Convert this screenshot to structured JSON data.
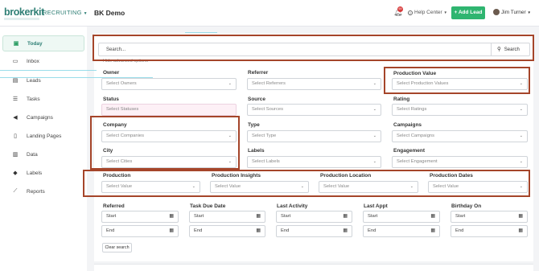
{
  "header": {
    "logo": "brokerkit",
    "app_switch": "RECRUITING",
    "page_title": "BK Demo",
    "notification_count": "69",
    "help_label": "Help Center",
    "add_lead_label": "+ Add Lead",
    "user_name": "Jim Turner"
  },
  "sidebar": {
    "items": [
      {
        "label": "Today",
        "icon": "calendar-check-icon",
        "glyph": "▣"
      },
      {
        "label": "Inbox",
        "icon": "inbox-icon",
        "glyph": "▭"
      },
      {
        "label": "Leads",
        "icon": "contact-card-icon",
        "glyph": "▤"
      },
      {
        "label": "Tasks",
        "icon": "list-icon",
        "glyph": "☰"
      },
      {
        "label": "Campaigns",
        "icon": "megaphone-icon",
        "glyph": "◀"
      },
      {
        "label": "Landing Pages",
        "icon": "document-icon",
        "glyph": "▯"
      },
      {
        "label": "Data",
        "icon": "database-icon",
        "glyph": "▥"
      },
      {
        "label": "Labels",
        "icon": "tags-icon",
        "glyph": "◆"
      },
      {
        "label": "Reports",
        "icon": "line-chart-icon",
        "glyph": "⟋"
      }
    ]
  },
  "search": {
    "placeholder": "Search...",
    "button_label": "Search",
    "toggle_label": "Hide advanced options"
  },
  "filters": {
    "owner": {
      "label": "Owner",
      "placeholder": "Select Owners"
    },
    "referrer": {
      "label": "Referrer",
      "placeholder": "Select Referrers"
    },
    "production_value": {
      "label": "Production Value",
      "placeholder": "Select Production Values"
    },
    "status": {
      "label": "Status",
      "placeholder": "Select Statuses"
    },
    "source": {
      "label": "Source",
      "placeholder": "Select Sources"
    },
    "rating": {
      "label": "Rating",
      "placeholder": "Select Ratings"
    },
    "company": {
      "label": "Company",
      "placeholder": "Select Companies"
    },
    "type": {
      "label": "Type",
      "placeholder": "Select Type"
    },
    "campaigns": {
      "label": "Campaigns",
      "placeholder": "Select Campaigns"
    },
    "city": {
      "label": "City",
      "placeholder": "Select Cities"
    },
    "labels": {
      "label": "Labels",
      "placeholder": "Select Labels"
    },
    "engagement": {
      "label": "Engagement",
      "placeholder": "Select Engagement"
    },
    "production": {
      "label": "Production",
      "placeholder": "Select Value"
    },
    "production_insights": {
      "label": "Production Insights",
      "placeholder": "Select Value"
    },
    "production_location": {
      "label": "Production Location",
      "placeholder": "Select Value"
    },
    "production_dates": {
      "label": "Production Dates",
      "placeholder": "Select Value"
    }
  },
  "date_filters": [
    {
      "label": "Referred",
      "start": "Start",
      "end": "End"
    },
    {
      "label": "Task Due Date",
      "start": "Start",
      "end": "End"
    },
    {
      "label": "Last Activity",
      "start": "Start",
      "end": "End"
    },
    {
      "label": "Last Appt",
      "start": "Start",
      "end": "End"
    },
    {
      "label": "Birthday On",
      "start": "Start",
      "end": "End"
    }
  ],
  "clear_label": "Clear search",
  "colors": {
    "brand": "#2f7f75",
    "accent_green": "#2fb570",
    "highlight_box": "#a5452a",
    "badge_red": "#d83b3b"
  }
}
